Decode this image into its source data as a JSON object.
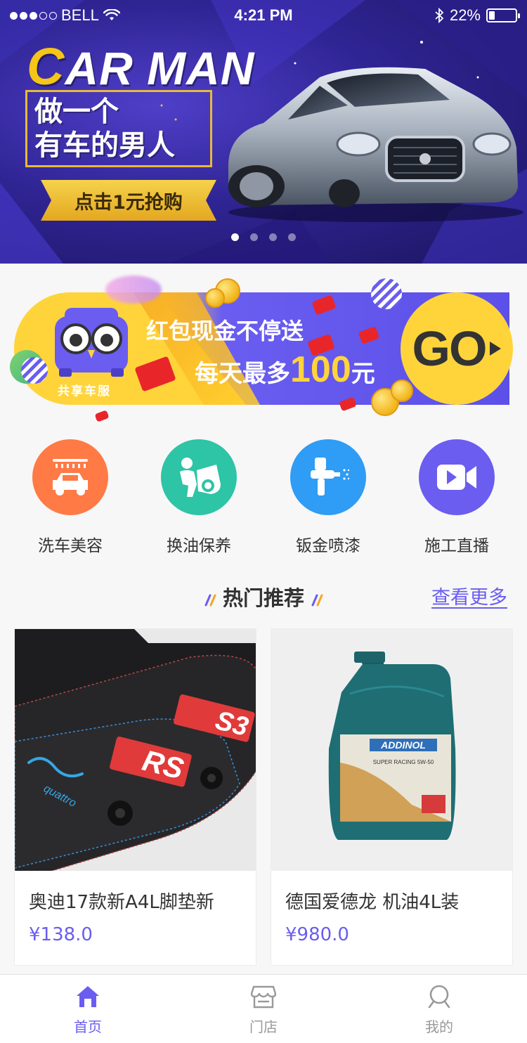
{
  "status_bar": {
    "carrier": "BELL",
    "time": "4:21 PM",
    "battery_percent": "22%",
    "battery_level": 0.22,
    "signal_bars": 3,
    "signal_total": 5
  },
  "hero": {
    "brand_first": "C",
    "brand_rest": "AR MAN",
    "slogan_line1": "做一个",
    "slogan_line2": "有车的男人",
    "cta": "点击1元抢购",
    "slide_count": 4,
    "active_slide": 0
  },
  "promo": {
    "mascot_label": "共享车服",
    "line1": "红包现金不停送",
    "line2_prefix": "每天最多",
    "line2_amount": "100",
    "line2_suffix": "元",
    "go_label": "GO"
  },
  "services": [
    {
      "label": "洗车美容",
      "color": "#ff7a45",
      "icon": "car-wash-icon"
    },
    {
      "label": "换油保养",
      "color": "#2ec4a6",
      "icon": "mechanic-icon"
    },
    {
      "label": "钣金喷漆",
      "color": "#2f9cf5",
      "icon": "spray-gun-icon"
    },
    {
      "label": "施工直播",
      "color": "#6a5df0",
      "icon": "video-camera-icon"
    }
  ],
  "section": {
    "title": "热门推荐",
    "more": "查看更多"
  },
  "products": [
    {
      "name": "奥迪17款新A4L脚垫新",
      "price": "¥138.0",
      "image": "car-floor-mat"
    },
    {
      "name": "德国爱德龙 机油4L装",
      "price": "¥980.0",
      "image": "motor-oil-bottle"
    }
  ],
  "tabbar": [
    {
      "label": "首页",
      "icon": "home-icon",
      "active": true
    },
    {
      "label": "门店",
      "icon": "store-icon",
      "active": false
    },
    {
      "label": "我的",
      "icon": "user-icon",
      "active": false
    }
  ],
  "colors": {
    "accent": "#6a5df0",
    "yellow": "#ffd43b",
    "hero_bg": "#2f2493"
  }
}
